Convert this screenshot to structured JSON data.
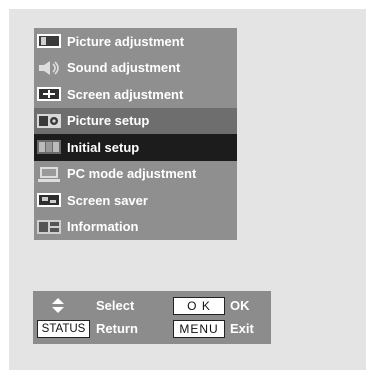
{
  "menu": {
    "items": [
      {
        "label": "Picture adjustment",
        "icon": "picture-icon"
      },
      {
        "label": "Sound adjustment",
        "icon": "sound-icon"
      },
      {
        "label": "Screen adjustment",
        "icon": "screen-icon"
      },
      {
        "label": "Picture setup",
        "icon": "picture-setup-icon"
      },
      {
        "label": "Initial setup",
        "icon": "initial-setup-icon",
        "selected": true
      },
      {
        "label": "PC mode adjustment",
        "icon": "pc-icon"
      },
      {
        "label": "Screen saver",
        "icon": "screen-saver-icon"
      },
      {
        "label": "Information",
        "icon": "information-icon"
      }
    ]
  },
  "guide": {
    "select_label": "Select",
    "ok_key": "O K",
    "ok_label": "OK",
    "status_key": "STATUS",
    "return_label": "Return",
    "menu_key": "MENU",
    "exit_label": "Exit"
  },
  "colors": {
    "panel_bg": "#e4e4e4",
    "menu_item_bg": "#8f8f8f",
    "menu_setup_bg": "#6e6e6e",
    "menu_selected_bg": "#1c1c1c",
    "guide_bg": "#8c8c8c"
  }
}
